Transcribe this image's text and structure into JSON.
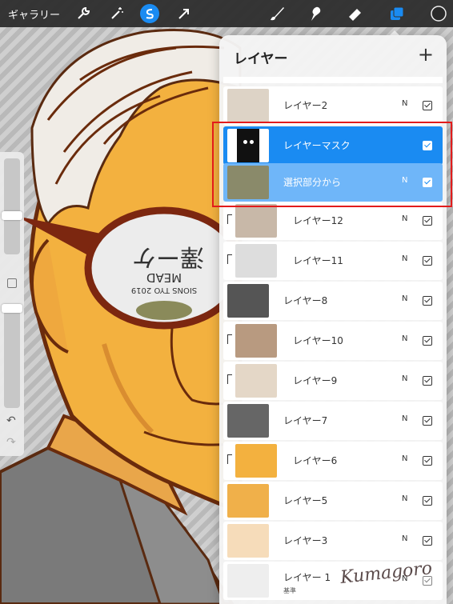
{
  "toolbar": {
    "gallery_label": "ギャラリー",
    "tools": [
      "wrench-icon",
      "magic-wand-icon",
      "selection-icon",
      "transform-arrow-icon"
    ],
    "right_tools": [
      "brush-icon",
      "smudge-icon",
      "eraser-icon",
      "layers-icon",
      "color-icon"
    ],
    "accent_color": "#1a8bf2"
  },
  "layers_panel": {
    "title": "レイヤー",
    "add_label": "+",
    "layers": [
      {
        "name": "レイヤー2",
        "mode": "N",
        "checked": true,
        "clipped": false,
        "selected": false
      },
      {
        "name": "レイヤーマスク",
        "mode": "",
        "checked": true,
        "clipped": false,
        "selected": true
      },
      {
        "name": "選択部分から",
        "mode": "N",
        "checked": true,
        "clipped": false,
        "selected": true
      },
      {
        "name": "レイヤー12",
        "mode": "N",
        "checked": true,
        "clipped": true,
        "selected": false
      },
      {
        "name": "レイヤー11",
        "mode": "N",
        "checked": true,
        "clipped": true,
        "selected": false
      },
      {
        "name": "レイヤー8",
        "mode": "N",
        "checked": true,
        "clipped": false,
        "selected": false
      },
      {
        "name": "レイヤー10",
        "mode": "N",
        "checked": true,
        "clipped": true,
        "selected": false
      },
      {
        "name": "レイヤー9",
        "mode": "N",
        "checked": true,
        "clipped": true,
        "selected": false
      },
      {
        "name": "レイヤー7",
        "mode": "N",
        "checked": true,
        "clipped": false,
        "selected": false
      },
      {
        "name": "レイヤー6",
        "mode": "N",
        "checked": true,
        "clipped": true,
        "selected": false
      },
      {
        "name": "レイヤー5",
        "mode": "N",
        "checked": true,
        "clipped": false,
        "selected": false
      },
      {
        "name": "レイヤー3",
        "mode": "N",
        "checked": true,
        "clipped": false,
        "selected": false
      },
      {
        "name": "レイヤー 1",
        "sub": "基準",
        "mode": "N",
        "checked": false,
        "clipped": false,
        "selected": false
      }
    ]
  },
  "sidebar": {
    "undo_icon": "undo-icon",
    "redo_icon": "redo-icon",
    "brush_size_level": 0.27,
    "opacity_level": 0.96
  },
  "canvas": {
    "lens_text_1": "澤ーケ",
    "lens_text_2": "MEAD",
    "lens_text_3": "SIONS TYO 2019"
  },
  "signature": "Kumagoro"
}
